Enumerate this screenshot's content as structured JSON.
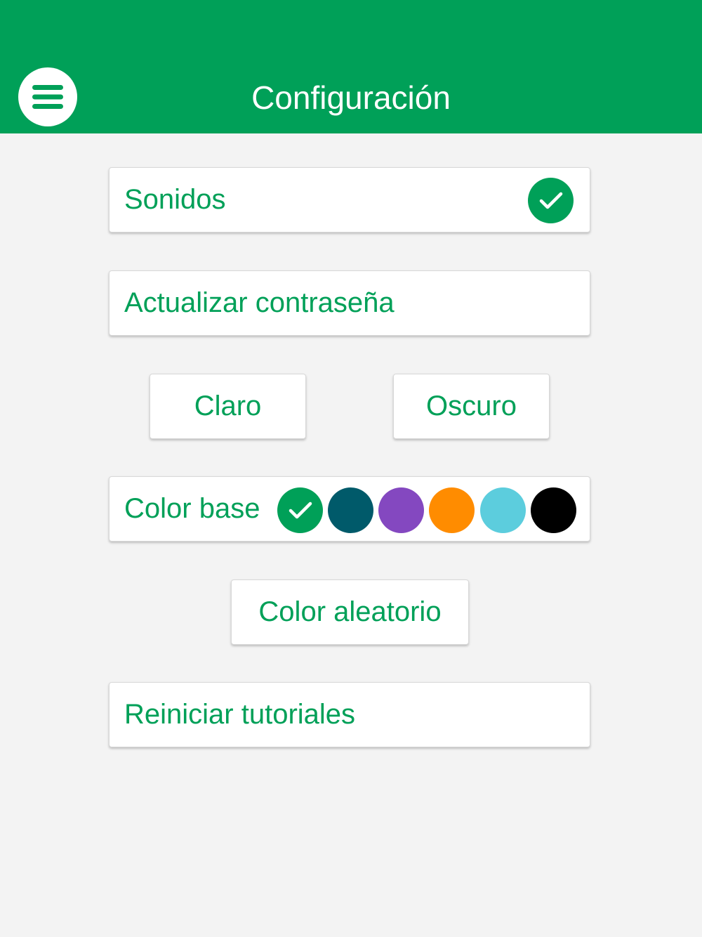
{
  "header": {
    "title": "Configuración",
    "background_color": "#00a058",
    "menu_icon": "hamburger-menu-icon"
  },
  "settings": {
    "sounds": {
      "label": "Sonidos",
      "enabled": true,
      "check_icon": "checkmark-icon"
    },
    "update_password": {
      "label": "Actualizar contraseña"
    },
    "theme": {
      "light_label": "Claro",
      "dark_label": "Oscuro"
    },
    "base_color": {
      "label": "Color base",
      "selected_index": 0,
      "colors": [
        "#00a058",
        "#005a6a",
        "#8448c0",
        "#ff8c00",
        "#5ccddd",
        "#000000"
      ]
    },
    "random_color": {
      "label": "Color aleatorio"
    },
    "reset_tutorials": {
      "label": "Reiniciar tutoriales"
    }
  },
  "accent_color": "#00a058",
  "page_background": "#f3f3f3"
}
